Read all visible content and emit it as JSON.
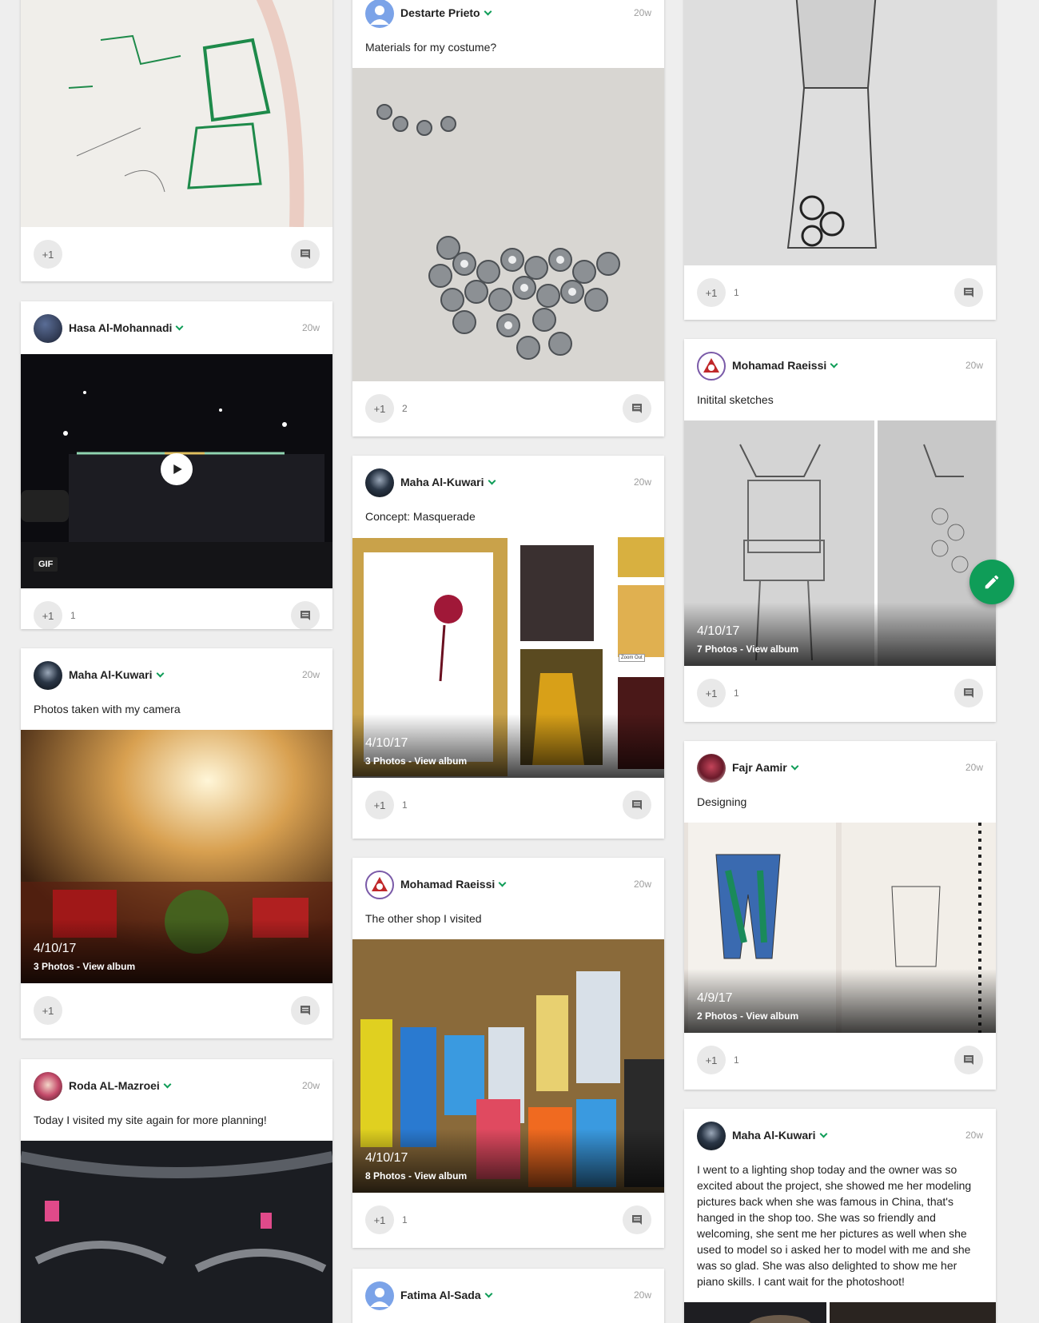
{
  "colors": {
    "accent": "#0f9d58",
    "page_bg": "#eeeeee"
  },
  "icons": {
    "plus_one": "plus-one-icon",
    "comment": "comment-bubble-icon",
    "edit": "pencil-icon",
    "play": "play-icon",
    "chevron": "chevron-down-icon"
  },
  "plus_label": "+1",
  "fab": {
    "icon": "pencil-icon"
  },
  "posts": {
    "c1a": {
      "count": ""
    },
    "c1b": {
      "author": "Hasa Al-Mohannadi",
      "time": "20w",
      "badge": "GIF",
      "count": "1"
    },
    "c1c": {
      "author": "Maha Al-Kuwari",
      "time": "20w",
      "text": "Photos taken with my camera",
      "album_date": "4/10/17",
      "album_sub": "3 Photos - View album",
      "count": ""
    },
    "c1d": {
      "author": "Roda AL-Mazroei",
      "time": "20w",
      "text": "Today I visited my site again for more planning!"
    },
    "c2a": {
      "author": "Destarte Prieto",
      "time": "20w",
      "text": "Materials for my costume?",
      "count": "2"
    },
    "c2b": {
      "author": "Maha Al-Kuwari",
      "time": "20w",
      "text": "Concept: Masquerade",
      "album_date": "4/10/17",
      "album_sub": "3 Photos - View album",
      "count": "1",
      "zoom_label": "Zoom Out"
    },
    "c2c": {
      "author": "Mohamad Raeissi",
      "time": "20w",
      "text": "The other shop I visited",
      "album_date": "4/10/17",
      "album_sub": "8 Photos - View album",
      "count": "1"
    },
    "c2d": {
      "author": "Fatima Al-Sada",
      "time": "20w"
    },
    "c3a": {
      "count": "1"
    },
    "c3b": {
      "author": "Mohamad Raeissi",
      "time": "20w",
      "text": "Initital sketches",
      "album_date": "4/10/17",
      "album_sub": "7 Photos - View album",
      "count": "1"
    },
    "c3c": {
      "author": "Fajr Aamir",
      "time": "20w",
      "text": "Designing",
      "album_date": "4/9/17",
      "album_sub": "2 Photos - View album",
      "count": "1"
    },
    "c3d": {
      "author": "Maha Al-Kuwari",
      "time": "20w",
      "text": "I went to a lighting shop today and the owner was so excited about the project, she showed me her modeling pictures back when she was famous in China, that's hanged in the shop too. She was so friendly and welcoming, she sent me her pictures as well when she used to model so i asked her to model with me and she was so glad. She was also delighted to show me her piano skills. I cant wait for the photoshoot!"
    }
  }
}
